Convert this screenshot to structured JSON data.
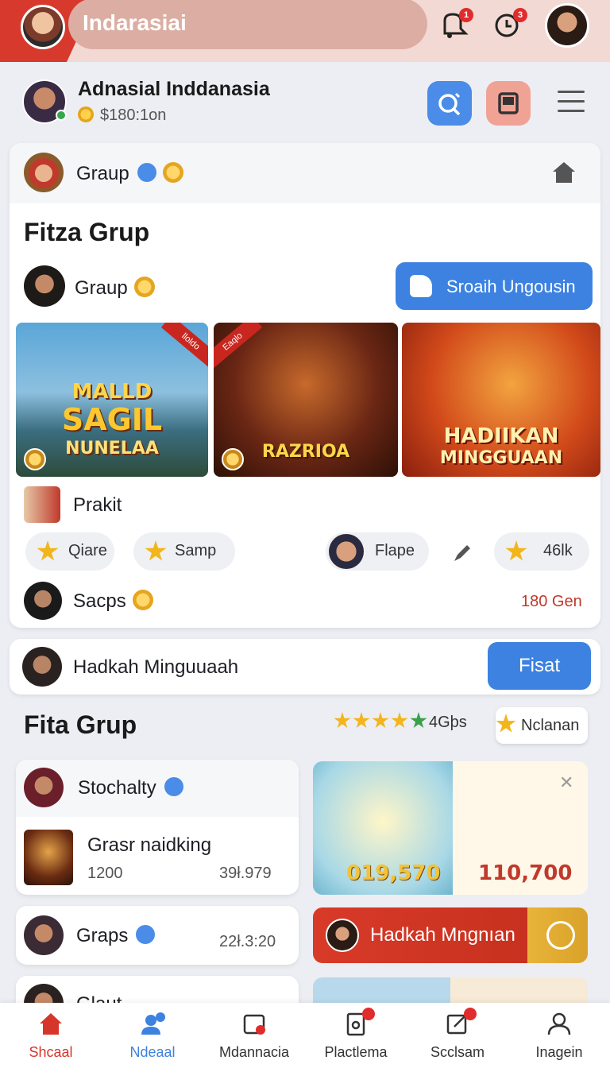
{
  "header": {
    "search_text": "Indarasiai",
    "notif1_badge": "1",
    "notif2_badge": "3"
  },
  "profile": {
    "name": "Adnasial Inddanasia",
    "balance": "$180:1on"
  },
  "card1": {
    "head_label": "Graup",
    "title": "Fitza Grup",
    "row_label": "Graup",
    "cta_label": "Sroaih Ungousin",
    "banners": [
      {
        "ribbon": "lloldo",
        "line1": "MALLD",
        "line2": "SAGIL",
        "line3": "NUNELAA"
      },
      {
        "ribbon": "Eaqlo",
        "line1": "RAZRIOA"
      },
      {
        "line1": "HADIIKAN",
        "line2": "MINGGUAAN"
      }
    ],
    "prakit": "Prakit",
    "chips": [
      "Qiare",
      "Samp",
      "Flape",
      "46lk"
    ],
    "sacps": "Sacps",
    "gen": "180 Gen"
  },
  "card2": {
    "label": "Hadkah Minguuaah",
    "button": "Fisat"
  },
  "section2": {
    "title": "Fita Grup",
    "rating_text": "4Gþs",
    "nclanan": "Nclanan"
  },
  "list": {
    "stochalty": "Stochalty",
    "item_title": "Grasr naidking",
    "item_left": "1200",
    "item_right": "39ł.979",
    "graps": "Graps",
    "graps_value": "22ł.3:20",
    "glaut": "Glaut"
  },
  "promos": {
    "value1": "019,570",
    "value2": "110,700",
    "banner": "Hadkah Mngnıan"
  },
  "nav": [
    {
      "label": "Shcaal",
      "color": "#d6362a"
    },
    {
      "label": "Ndeaal",
      "color": "#3d82e0"
    },
    {
      "label": "Mdannacia",
      "color": "#333333"
    },
    {
      "label": "Plactlema",
      "color": "#333333"
    },
    {
      "label": "Scclsam",
      "color": "#333333"
    },
    {
      "label": "Inagein",
      "color": "#333333"
    }
  ]
}
